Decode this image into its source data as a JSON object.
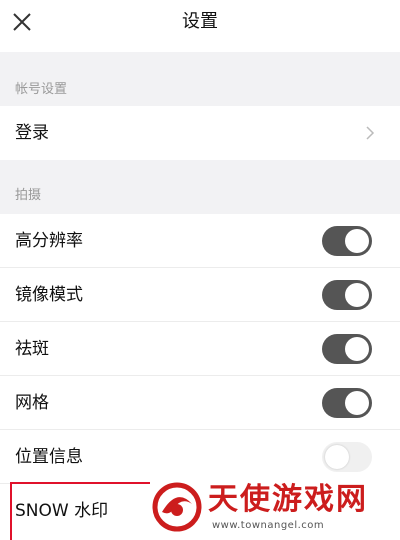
{
  "header": {
    "title": "设置",
    "close_icon": "close-icon"
  },
  "sections": [
    {
      "title": "帐号设置"
    },
    {
      "title": "拍摄"
    }
  ],
  "account": {
    "login_label": "登录",
    "chevron_icon": "chevron-right-icon"
  },
  "camera_settings": [
    {
      "label": "高分辨率",
      "enabled": true
    },
    {
      "label": "镜像模式",
      "enabled": true
    },
    {
      "label": "祛斑",
      "enabled": true
    },
    {
      "label": "网格",
      "enabled": true
    },
    {
      "label": "位置信息",
      "enabled": false
    },
    {
      "label": "SNOW 水印"
    }
  ],
  "watermark": {
    "text": "天使游戏网",
    "url": "www.townangel.com"
  },
  "colors": {
    "toggle_on": "#555555",
    "toggle_off": "#f0f0f0",
    "highlight": "#e0112b",
    "watermark_red": "#cc1d1d"
  }
}
